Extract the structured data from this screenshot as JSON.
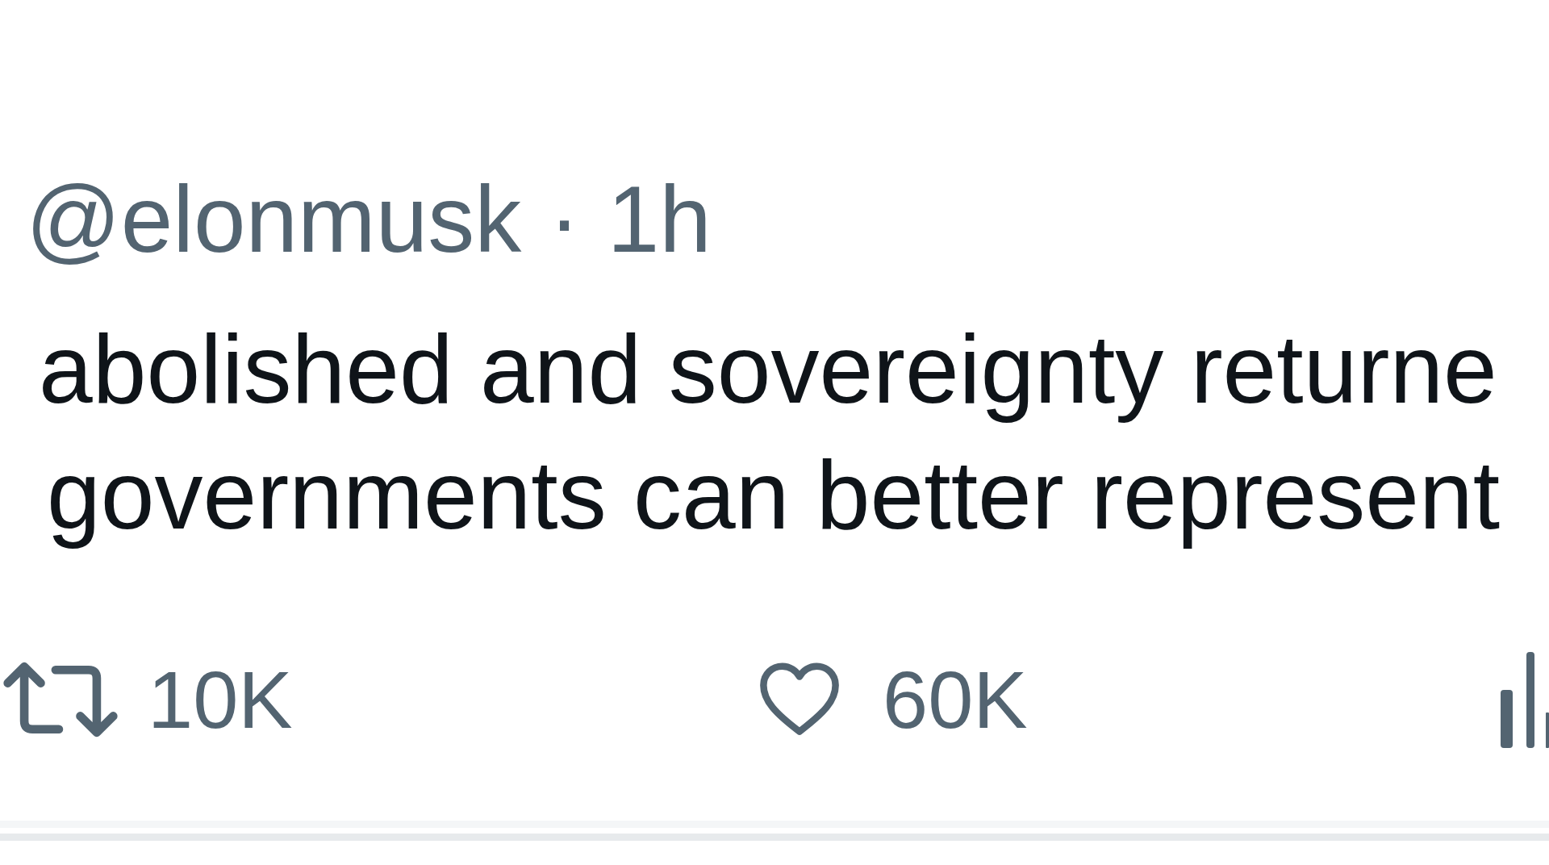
{
  "tweet": {
    "handle": "@elonmusk",
    "separator": "·",
    "time": "1h",
    "text_lines": [
      "abolished and sovereignty returne",
      "governments can better represent"
    ],
    "actions": [
      {
        "kind": "retweet",
        "count": "10K"
      },
      {
        "kind": "like",
        "count": "60K"
      },
      {
        "kind": "views"
      }
    ]
  }
}
